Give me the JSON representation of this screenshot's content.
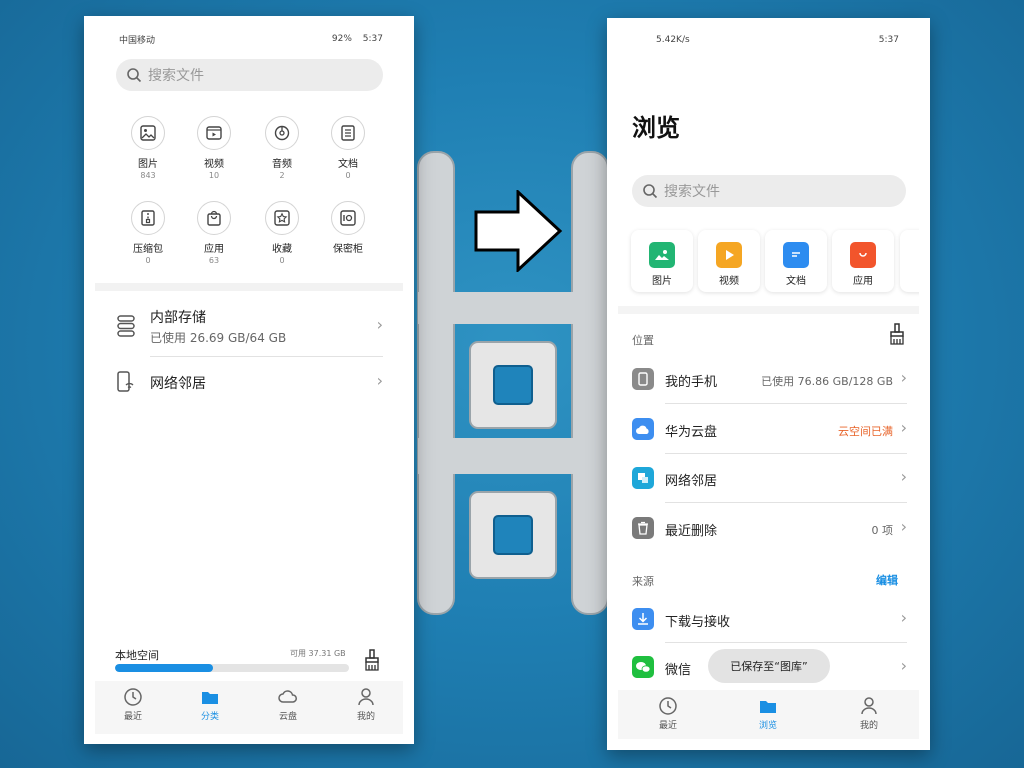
{
  "left_phone": {
    "status_bar": {
      "carrier": "中国移动",
      "battery": "92%",
      "time": "5:37"
    },
    "search": {
      "placeholder": "搜索文件"
    },
    "categories": [
      {
        "label": "图片",
        "count": "843",
        "icon": "image-icon"
      },
      {
        "label": "视频",
        "count": "10",
        "icon": "video-icon"
      },
      {
        "label": "音频",
        "count": "2",
        "icon": "audio-icon"
      },
      {
        "label": "文档",
        "count": "0",
        "icon": "document-icon"
      },
      {
        "label": "压缩包",
        "count": "0",
        "icon": "zip-icon"
      },
      {
        "label": "应用",
        "count": "63",
        "icon": "app-bag-icon"
      },
      {
        "label": "收藏",
        "count": "0",
        "icon": "star-icon"
      },
      {
        "label": "保密柜",
        "count": "",
        "icon": "safe-icon"
      }
    ],
    "storage_rows": [
      {
        "title": "内部存储",
        "subtitle": "已使用 26.69 GB/64 GB"
      },
      {
        "title": "网络邻居",
        "subtitle": ""
      }
    ],
    "local_space": {
      "label": "本地空间",
      "available": "可用 37.31 GB",
      "used_fraction": 0.42
    },
    "tabs": [
      {
        "label": "最近",
        "active": false
      },
      {
        "label": "分类",
        "active": true
      },
      {
        "label": "云盘",
        "active": false
      },
      {
        "label": "我的",
        "active": false
      }
    ]
  },
  "right_phone": {
    "status_bar": {
      "speed": "5.42K/s",
      "time": "5:37"
    },
    "title": "浏览",
    "search": {
      "placeholder": "搜索文件"
    },
    "quick_cards": [
      {
        "label": "图片",
        "color": "#22b573"
      },
      {
        "label": "视频",
        "color": "#f5a623"
      },
      {
        "label": "文档",
        "color": "#2d8cf0"
      },
      {
        "label": "应用",
        "color": "#f2552c"
      }
    ],
    "location_section": {
      "header": "位置"
    },
    "locations": [
      {
        "title": "我的手机",
        "detail": "已使用 76.86 GB/128 GB",
        "icon_color": "#8a8a8a"
      },
      {
        "title": "华为云盘",
        "detail": "云空间已满",
        "icon_color": "#3d8ef0"
      },
      {
        "title": "网络邻居",
        "detail": "",
        "icon_color": "#1ea7d9"
      },
      {
        "title": "最近删除",
        "detail": "0 项",
        "icon_color": "#7a7a7a"
      }
    ],
    "source_section": {
      "header": "来源",
      "edit": "编辑"
    },
    "sources": [
      {
        "title": "下载与接收",
        "icon_color": "#3d8ef0"
      },
      {
        "title": "微信",
        "icon_color": "#1fbf3f"
      }
    ],
    "toast": "已保存至“图库”",
    "tabs": [
      {
        "label": "最近",
        "active": false
      },
      {
        "label": "浏览",
        "active": true
      },
      {
        "label": "我的",
        "active": false
      }
    ],
    "accent_color": "#1a8fe3",
    "warning_color": "#e8652b"
  }
}
